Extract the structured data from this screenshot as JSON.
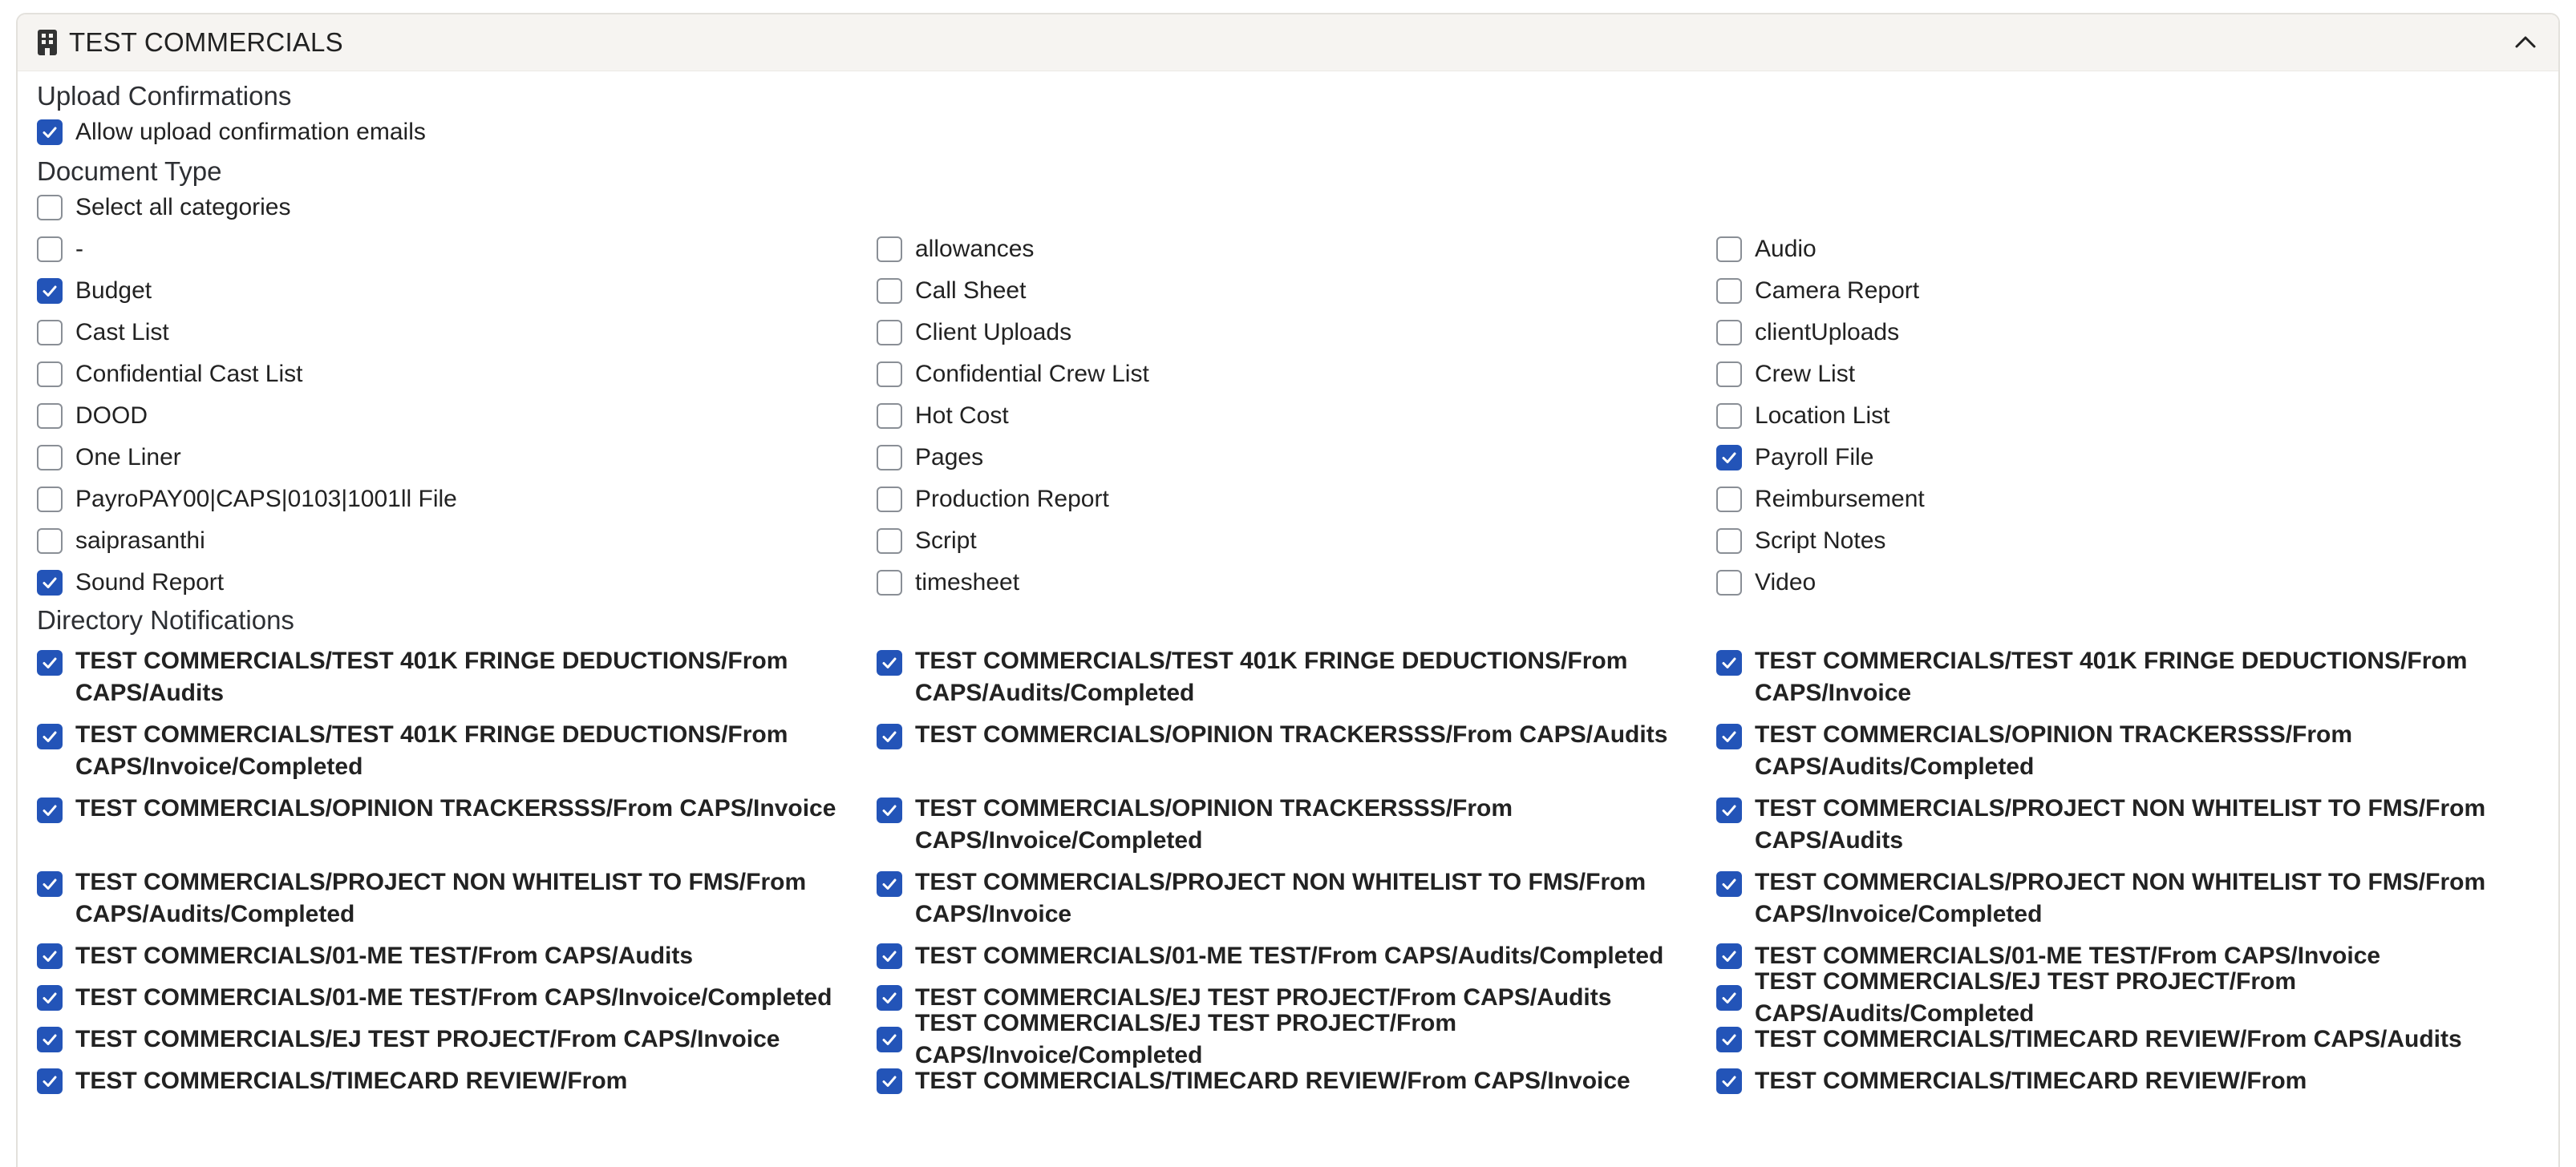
{
  "header": {
    "title": "TEST COMMERCIALS",
    "icon": "building-icon",
    "collapse_icon": "chevron-up-icon"
  },
  "upload": {
    "title": "Upload Confirmations",
    "option": {
      "label": "Allow upload confirmation emails",
      "checked": true
    }
  },
  "doctype": {
    "title": "Document Type",
    "select_all": {
      "label": "Select all categories",
      "checked": false
    },
    "items": [
      {
        "label": "-",
        "checked": false
      },
      {
        "label": "allowances",
        "checked": false
      },
      {
        "label": "Audio",
        "checked": false
      },
      {
        "label": "Budget",
        "checked": true
      },
      {
        "label": "Call Sheet",
        "checked": false
      },
      {
        "label": "Camera Report",
        "checked": false
      },
      {
        "label": "Cast List",
        "checked": false
      },
      {
        "label": "Client Uploads",
        "checked": false
      },
      {
        "label": "clientUploads",
        "checked": false
      },
      {
        "label": "Confidential Cast List",
        "checked": false
      },
      {
        "label": "Confidential Crew List",
        "checked": false
      },
      {
        "label": "Crew List",
        "checked": false
      },
      {
        "label": "DOOD",
        "checked": false
      },
      {
        "label": "Hot Cost",
        "checked": false
      },
      {
        "label": "Location List",
        "checked": false
      },
      {
        "label": "One Liner",
        "checked": false
      },
      {
        "label": "Pages",
        "checked": false
      },
      {
        "label": "Payroll File",
        "checked": true
      },
      {
        "label": "PayroPAY00|CAPS|0103|1001ll File",
        "checked": false
      },
      {
        "label": "Production Report",
        "checked": false
      },
      {
        "label": "Reimbursement",
        "checked": false
      },
      {
        "label": "saiprasanthi",
        "checked": false
      },
      {
        "label": "Script",
        "checked": false
      },
      {
        "label": "Script Notes",
        "checked": false
      },
      {
        "label": "Sound Report",
        "checked": true
      },
      {
        "label": "timesheet",
        "checked": false
      },
      {
        "label": "Video",
        "checked": false
      }
    ]
  },
  "directory": {
    "title": "Directory Notifications",
    "rows": [
      {
        "double": true,
        "items": [
          {
            "label": "TEST COMMERCIALS/TEST 401K FRINGE DEDUCTIONS/From CAPS/Audits",
            "checked": true
          },
          {
            "label": "TEST COMMERCIALS/TEST 401K FRINGE DEDUCTIONS/From CAPS/Audits/Completed",
            "checked": true
          },
          {
            "label": "TEST COMMERCIALS/TEST 401K FRINGE DEDUCTIONS/From CAPS/Invoice",
            "checked": true
          }
        ]
      },
      {
        "double": true,
        "items": [
          {
            "label": "TEST COMMERCIALS/TEST 401K FRINGE DEDUCTIONS/From CAPS/Invoice/Completed",
            "checked": true
          },
          {
            "label": "TEST COMMERCIALS/OPINION TRACKERSSS/From CAPS/Audits",
            "checked": true
          },
          {
            "label": "TEST COMMERCIALS/OPINION TRACKERSSS/From CAPS/Audits/Completed",
            "checked": true
          }
        ]
      },
      {
        "double": true,
        "items": [
          {
            "label": "TEST COMMERCIALS/OPINION TRACKERSSS/From CAPS/Invoice",
            "checked": true
          },
          {
            "label": "TEST COMMERCIALS/OPINION TRACKERSSS/From CAPS/Invoice/Completed",
            "checked": true
          },
          {
            "label": "TEST COMMERCIALS/PROJECT NON WHITELIST TO FMS/From CAPS/Audits",
            "checked": true
          }
        ]
      },
      {
        "double": true,
        "items": [
          {
            "label": "TEST COMMERCIALS/PROJECT NON WHITELIST TO FMS/From CAPS/Audits/Completed",
            "checked": true
          },
          {
            "label": "TEST COMMERCIALS/PROJECT NON WHITELIST TO FMS/From CAPS/Invoice",
            "checked": true
          },
          {
            "label": "TEST COMMERCIALS/PROJECT NON WHITELIST TO FMS/From CAPS/Invoice/Completed",
            "checked": true
          }
        ]
      },
      {
        "double": false,
        "items": [
          {
            "label": "TEST COMMERCIALS/01-ME TEST/From CAPS/Audits",
            "checked": true
          },
          {
            "label": "TEST COMMERCIALS/01-ME TEST/From CAPS/Audits/Completed",
            "checked": true
          },
          {
            "label": "TEST COMMERCIALS/01-ME TEST/From CAPS/Invoice",
            "checked": true
          }
        ]
      },
      {
        "double": false,
        "items": [
          {
            "label": "TEST COMMERCIALS/01-ME TEST/From CAPS/Invoice/Completed",
            "checked": true
          },
          {
            "label": "TEST COMMERCIALS/EJ TEST PROJECT/From CAPS/Audits",
            "checked": true
          },
          {
            "label": "TEST COMMERCIALS/EJ TEST PROJECT/From CAPS/Audits/Completed",
            "checked": true
          }
        ]
      },
      {
        "double": false,
        "items": [
          {
            "label": "TEST COMMERCIALS/EJ TEST PROJECT/From CAPS/Invoice",
            "checked": true
          },
          {
            "label": "TEST COMMERCIALS/EJ TEST PROJECT/From CAPS/Invoice/Completed",
            "checked": true
          },
          {
            "label": "TEST COMMERCIALS/TIMECARD REVIEW/From CAPS/Audits",
            "checked": true
          }
        ]
      },
      {
        "double": false,
        "items": [
          {
            "label": "TEST COMMERCIALS/TIMECARD REVIEW/From",
            "checked": true
          },
          {
            "label": "TEST COMMERCIALS/TIMECARD REVIEW/From CAPS/Invoice",
            "checked": true
          },
          {
            "label": "TEST COMMERCIALS/TIMECARD REVIEW/From",
            "checked": true
          }
        ]
      }
    ]
  },
  "colors": {
    "accent": "#2354b8",
    "header_bg": "#f6f4f1",
    "border": "#e3e1dc"
  }
}
